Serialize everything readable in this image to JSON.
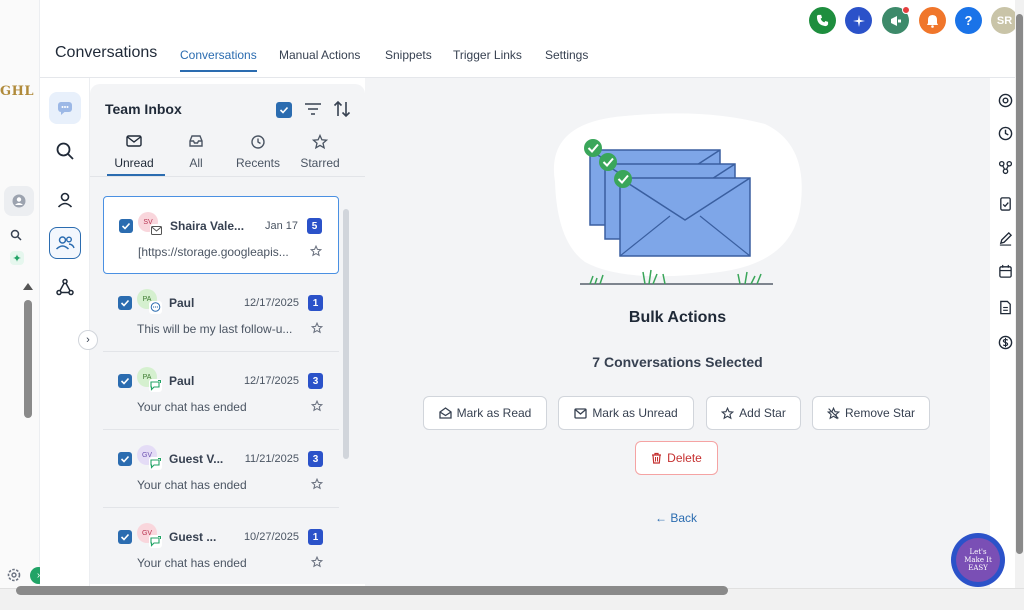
{
  "sliver": {
    "brand": "GHL"
  },
  "header": {
    "title": "Conversations",
    "tabs": [
      {
        "label": "Conversations",
        "active": true
      },
      {
        "label": "Manual Actions"
      },
      {
        "label": "Snippets"
      },
      {
        "label": "Trigger Links"
      },
      {
        "label": "Settings"
      }
    ],
    "user_initials": "SR",
    "help_glyph": "?",
    "top_icons": [
      {
        "icon": "phone-icon",
        "color": "#1e8e3e"
      },
      {
        "icon": "sparkle-icon",
        "color": "#2b52c9"
      },
      {
        "icon": "megaphone-icon",
        "color": "#3d8a6a"
      },
      {
        "icon": "bell-icon",
        "color": "#f0762b"
      },
      {
        "icon": "help-icon",
        "color": "#1a73e8"
      },
      {
        "icon": "user-avatar",
        "color": "#c9c4a8"
      }
    ]
  },
  "inbox": {
    "title": "Team Inbox",
    "filters": [
      {
        "label": "Unread",
        "icon": "envelope-icon",
        "active": true
      },
      {
        "label": "All",
        "icon": "inbox-icon"
      },
      {
        "label": "Recents",
        "icon": "clock-icon"
      },
      {
        "label": "Starred",
        "icon": "star-icon"
      }
    ],
    "conversations": [
      {
        "initials": "SV",
        "name": "Shaira Vale...",
        "date": "Jan 17",
        "badge": "5",
        "preview": "[https://storage.googleapis...",
        "avatar_bg": "#f9d6dc",
        "avatar_fg": "#b83250",
        "channel": "email-icon"
      },
      {
        "initials": "PA",
        "name": "Paul",
        "date": "12/17/2025",
        "badge": "1",
        "preview": "This will be my last follow-u...",
        "avatar_bg": "#d5f0cf",
        "avatar_fg": "#3a7a2e",
        "channel": "chat-icon"
      },
      {
        "initials": "PA",
        "name": "Paul",
        "date": "12/17/2025",
        "badge": "3",
        "preview": "Your chat has ended",
        "avatar_bg": "#d5f0cf",
        "avatar_fg": "#3a7a2e",
        "channel": "live-chat-icon"
      },
      {
        "initials": "GV",
        "name": "Guest V...",
        "date": "11/21/2025",
        "badge": "3",
        "preview": "Your chat has ended",
        "avatar_bg": "#e4dcf6",
        "avatar_fg": "#6b4fb0",
        "channel": "live-chat-icon"
      },
      {
        "initials": "GV",
        "name": "Guest ...",
        "date": "10/27/2025",
        "badge": "1",
        "preview": "Your chat has ended",
        "avatar_bg": "#f9d6dc",
        "avatar_fg": "#b83250",
        "channel": "live-chat-icon"
      }
    ]
  },
  "bulk": {
    "title": "Bulk Actions",
    "selected_text": "7 Conversations Selected",
    "mark_read": "Mark as Read",
    "mark_unread": "Mark as Unread",
    "add_star": "Add Star",
    "remove_star": "Remove Star",
    "delete": "Delete",
    "back": "← Back"
  },
  "help_bubble": {
    "text": "Let's Make It EASY"
  },
  "colors": {
    "accent": "#2b6cb0",
    "badge": "#2b52c9",
    "danger": "#c53030"
  }
}
